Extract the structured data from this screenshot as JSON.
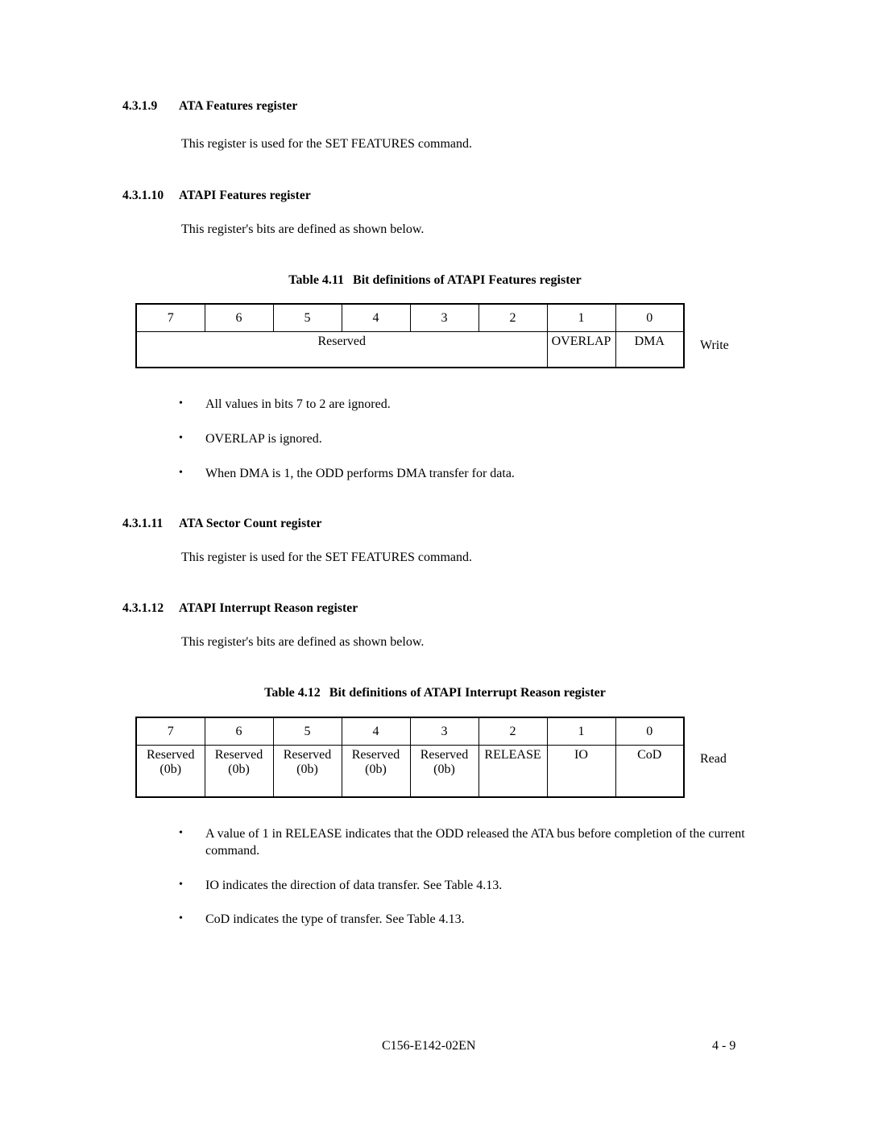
{
  "sections": [
    {
      "number": "4.3.1.9",
      "title": "ATA Features register",
      "body": "This register is used for the SET FEATURES command."
    },
    {
      "number": "4.3.1.10",
      "title": "ATAPI Features register",
      "body": "This register's bits are defined as shown below."
    },
    {
      "number": "4.3.1.11",
      "title": "ATA Sector Count register",
      "body": "This register is used for the SET FEATURES command."
    },
    {
      "number": "4.3.1.12",
      "title": "ATAPI Interrupt Reason register",
      "body": "This register's bits are defined as shown below."
    }
  ],
  "table_411": {
    "caption_number": "Table 4.11",
    "caption_title": "Bit definitions of ATAPI Features register",
    "bit_numbers": [
      "7",
      "6",
      "5",
      "4",
      "3",
      "2",
      "1",
      "0"
    ],
    "values": [
      {
        "label": "Reserved",
        "span": 6,
        "small": false
      },
      {
        "label": "OVERLAP",
        "span": 1,
        "small": true
      },
      {
        "label": "DMA",
        "span": 1,
        "small": false
      }
    ],
    "access_label": "Write"
  },
  "table_411_notes": [
    "All values in bits 7 to 2 are ignored.",
    "OVERLAP is ignored.",
    "When DMA is 1, the ODD performs DMA transfer for data."
  ],
  "table_412": {
    "caption_number": "Table 4.12",
    "caption_title": "Bit definitions of ATAPI Interrupt Reason register",
    "bit_numbers": [
      "7",
      "6",
      "5",
      "4",
      "3",
      "2",
      "1",
      "0"
    ],
    "values": [
      {
        "line1": "Reserved",
        "line2": "(0b)",
        "small": false
      },
      {
        "line1": "Reserved",
        "line2": "(0b)",
        "small": false
      },
      {
        "line1": "Reserved",
        "line2": "(0b)",
        "small": false
      },
      {
        "line1": "Reserved",
        "line2": "(0b)",
        "small": false
      },
      {
        "line1": "Reserved",
        "line2": "(0b)",
        "small": false
      },
      {
        "line1": "RELEASE",
        "line2": "",
        "small": true
      },
      {
        "line1": "IO",
        "line2": "",
        "small": false
      },
      {
        "line1": "CoD",
        "line2": "",
        "small": false
      }
    ],
    "access_label": "Read"
  },
  "table_412_notes": [
    "A value of 1 in RELEASE indicates that the ODD released the ATA bus before completion of the current command.",
    "IO indicates the direction of data transfer.  See Table 4.13.",
    "CoD indicates the type of transfer.  See Table 4.13."
  ],
  "footer": {
    "document_id": "C156-E142-02EN",
    "page_number": "4 - 9"
  },
  "bullet_glyph": "•"
}
